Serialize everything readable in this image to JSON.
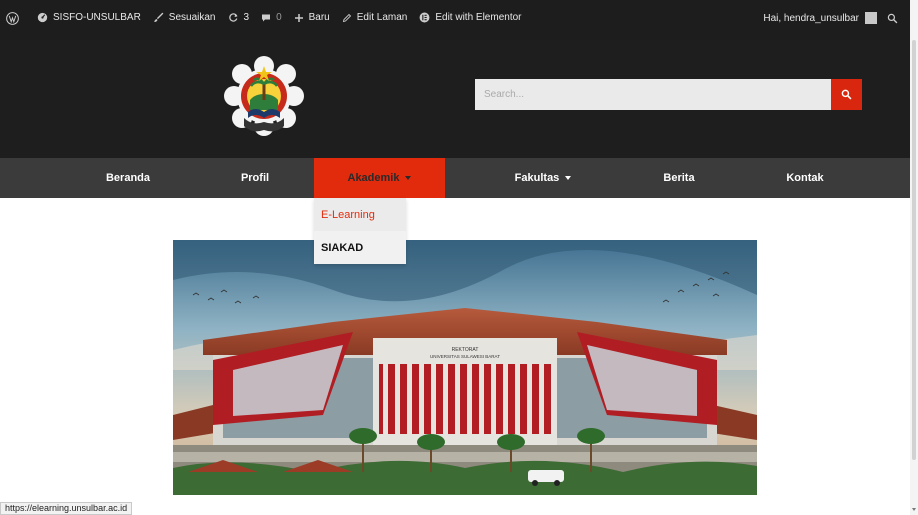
{
  "adminbar": {
    "site": "SISFO-UNSULBAR",
    "customize": "Sesuaikan",
    "updates": "3",
    "comments": "0",
    "new": "Baru",
    "edit_page": "Edit Laman",
    "elementor": "Edit with Elementor",
    "greeting": "Hai, hendra_unsulbar"
  },
  "header": {
    "search_placeholder": "Search..."
  },
  "nav": {
    "items": [
      {
        "label": "Beranda"
      },
      {
        "label": "Profil"
      },
      {
        "label": "Akademik"
      },
      {
        "label": "Fakultas"
      },
      {
        "label": "Berita"
      },
      {
        "label": "Kontak"
      }
    ],
    "active_index": 2
  },
  "dropdown": {
    "items": [
      {
        "label": "E-Learning"
      },
      {
        "label": "SIAKAD"
      }
    ]
  },
  "banner": {
    "building_sign_line1": "REKTORAT",
    "building_sign_line2": "UNIVERSITAS SULAWESI BARAT"
  },
  "logo": {
    "ring_text": "UNIVERSITAS SULAWESI BARAT"
  },
  "statusbar": {
    "url": "https://elearning.unsulbar.ac.id"
  },
  "colors": {
    "accent": "#e22b0c",
    "header_bg": "#1e1e1e",
    "nav_bg": "#3b3b3b",
    "adminbar_bg": "#1d1d1d"
  }
}
